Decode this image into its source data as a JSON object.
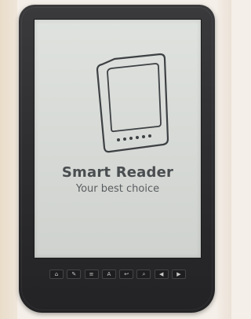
{
  "screen": {
    "brand": "Smart Reader",
    "tagline": "Your best choice"
  },
  "hardware_buttons": [
    {
      "icon": "home-icon",
      "glyph": "⌂"
    },
    {
      "icon": "bookmark-icon",
      "glyph": "✎"
    },
    {
      "icon": "menu-icon",
      "glyph": "≡"
    },
    {
      "icon": "font-size-icon",
      "glyph": "A"
    },
    {
      "icon": "back-icon",
      "glyph": "↩"
    },
    {
      "icon": "zoom-icon",
      "glyph": "⌕"
    },
    {
      "icon": "previous-page-icon",
      "glyph": "◀"
    },
    {
      "icon": "next-page-icon",
      "glyph": "▶"
    }
  ],
  "colors": {
    "device_body": "#2b2b2d",
    "screen": "#d9dcd8",
    "brand_text": "#4a4d50"
  }
}
